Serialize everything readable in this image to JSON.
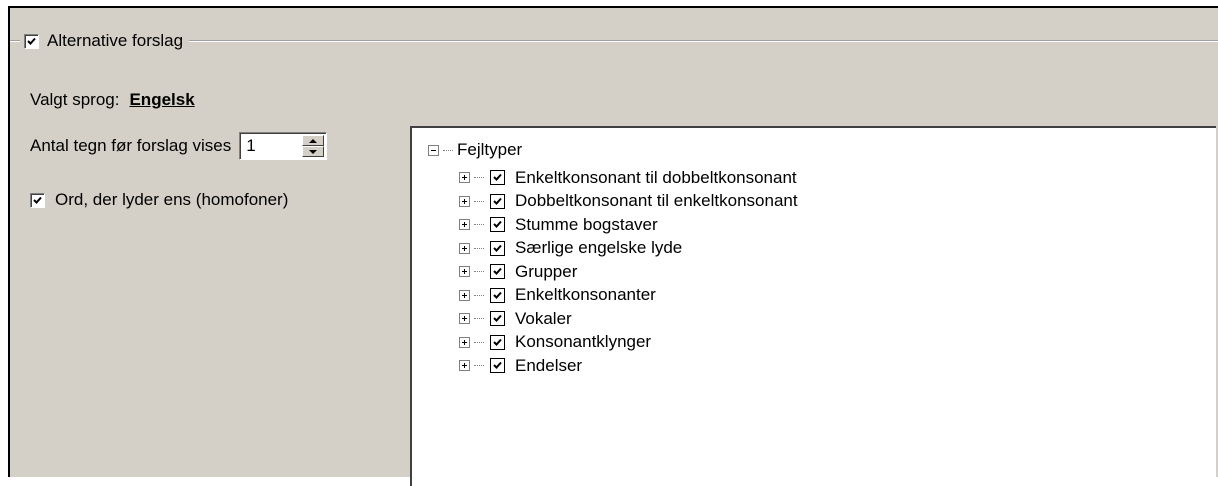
{
  "group": {
    "label": "Alternative forslag",
    "checked": true
  },
  "language": {
    "label": "Valgt sprog:",
    "value": "Engelsk"
  },
  "antal": {
    "label": "Antal tegn før forslag vises",
    "value": "1"
  },
  "homofoner": {
    "label": "Ord, der lyder ens (homofoner)",
    "checked": true
  },
  "tree": {
    "root_label": "Fejltyper",
    "items": [
      {
        "label": "Enkeltkonsonant til dobbeltkonsonant",
        "checked": true
      },
      {
        "label": "Dobbeltkonsonant til enkeltkonsonant",
        "checked": true
      },
      {
        "label": "Stumme bogstaver",
        "checked": true
      },
      {
        "label": "Særlige engelske lyde",
        "checked": true
      },
      {
        "label": "Grupper",
        "checked": true
      },
      {
        "label": "Enkeltkonsonanter",
        "checked": true
      },
      {
        "label": "Vokaler",
        "checked": true
      },
      {
        "label": "Konsonantklynger",
        "checked": true
      },
      {
        "label": "Endelser",
        "checked": true
      }
    ]
  },
  "icons": {
    "check": "check-icon",
    "expand": "plus-expander-icon",
    "collapse": "minus-expander-icon",
    "spin_up": "arrow-up-icon",
    "spin_down": "arrow-down-icon"
  },
  "colors": {
    "panel": "#d4d0c8",
    "tree_bg": "#ffffff"
  }
}
